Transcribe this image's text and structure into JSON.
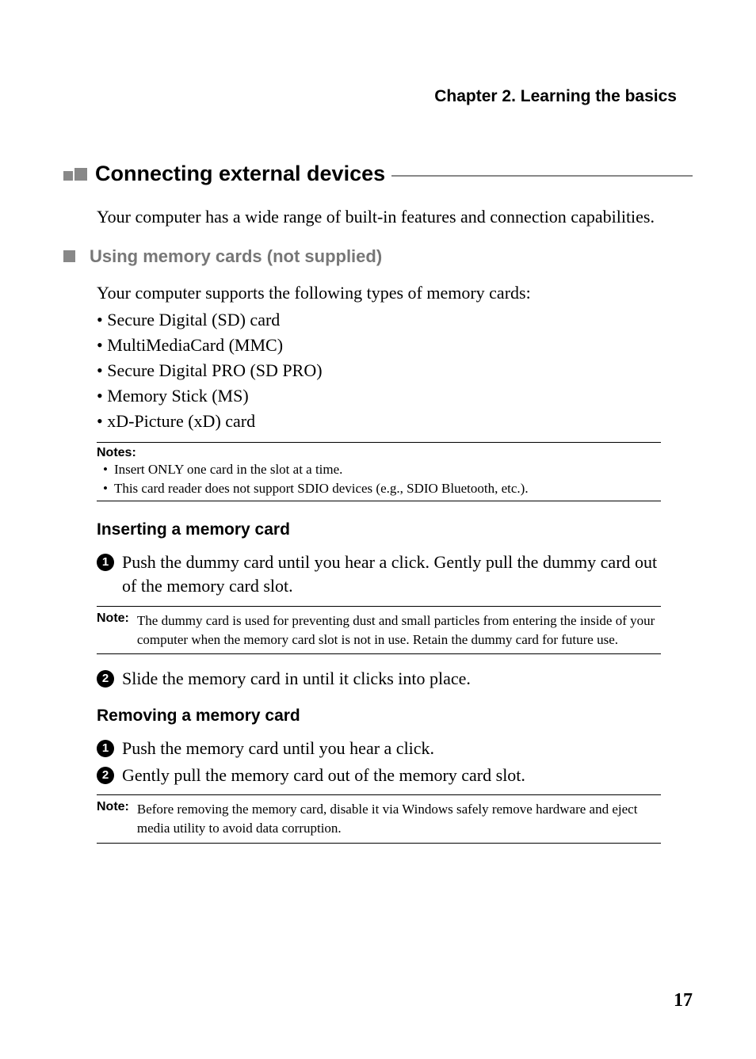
{
  "header": {
    "chapter": "Chapter 2. Learning the basics"
  },
  "section": {
    "title": "Connecting external devices",
    "intro": "Your computer has a wide range of built-in features and connection capabilities."
  },
  "memory_cards": {
    "title": "Using memory cards (not supplied)",
    "intro": "Your computer supports the following types of memory cards:",
    "items": [
      "Secure Digital (SD) card",
      "MultiMediaCard (MMC)",
      "Secure Digital PRO (SD PRO)",
      "Memory Stick (MS)",
      "xD-Picture (xD) card"
    ],
    "notes_label": "Notes:",
    "notes": [
      "Insert ONLY one card in the slot at a time.",
      "This card reader does not support SDIO devices (e.g., SDIO Bluetooth, etc.)."
    ]
  },
  "inserting": {
    "title": "Inserting a memory card",
    "steps": [
      "Push the dummy card until you hear a click. Gently pull the dummy card out of the memory card slot.",
      "Slide the memory card in until it clicks into place."
    ],
    "note_label": "Note:",
    "note": "The dummy card is used for preventing dust and small particles from entering the inside of your computer when the memory card slot is not in use. Retain the dummy card for future use."
  },
  "removing": {
    "title": "Removing a memory card",
    "steps": [
      "Push the memory card until you hear a click.",
      "Gently pull the memory card out of the memory card slot."
    ],
    "note_label": "Note:",
    "note": "Before removing the memory card, disable it via Windows safely remove hardware and eject media utility to avoid data corruption."
  },
  "page_number": "17"
}
